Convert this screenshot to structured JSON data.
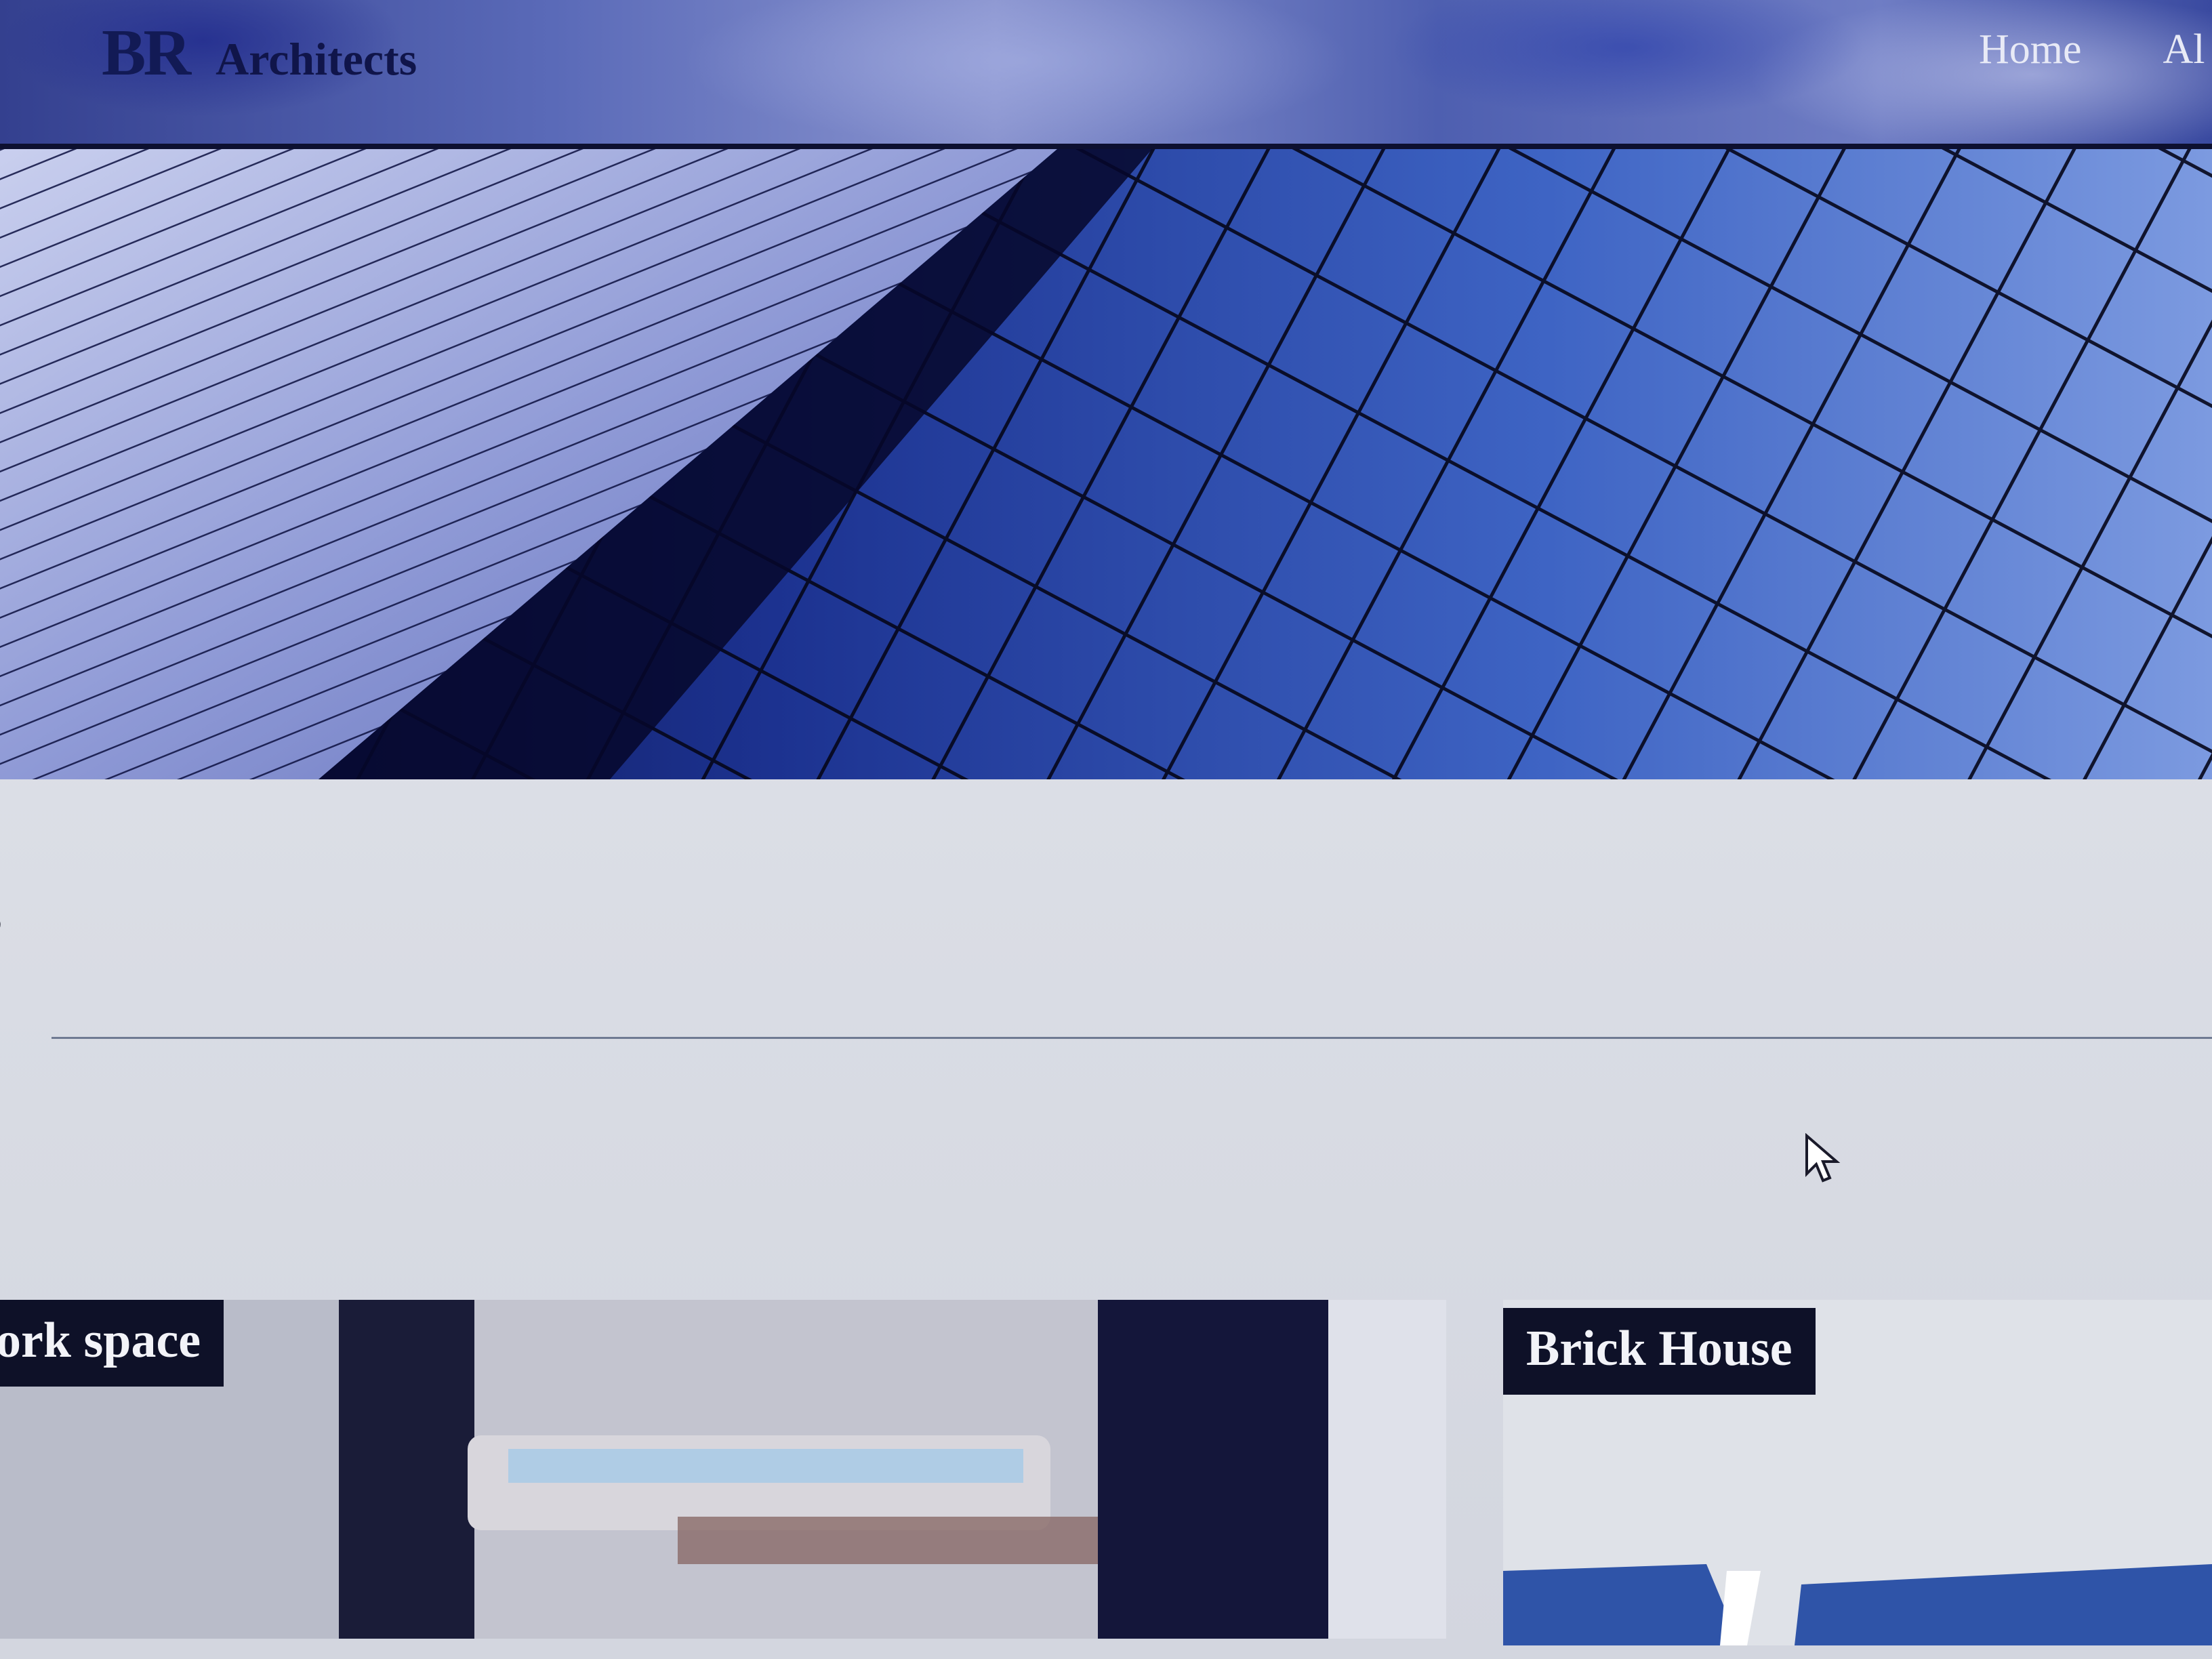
{
  "brand": {
    "mark": "BR",
    "name": "Architects"
  },
  "nav": {
    "items": [
      "Home",
      "Al"
    ]
  },
  "section": {
    "heading_fragment": "s"
  },
  "cards": [
    {
      "title": "ork space"
    },
    {
      "title": "Brick House"
    }
  ],
  "colors": {
    "navbar": "#5a6ab8",
    "hero_dark": "#0a0c2e",
    "hero_blue": "#2a4aa8",
    "label_bg": "#0e1128",
    "page_bg": "#dcdfe6"
  },
  "icons": [
    "mouse-pointer-icon"
  ]
}
